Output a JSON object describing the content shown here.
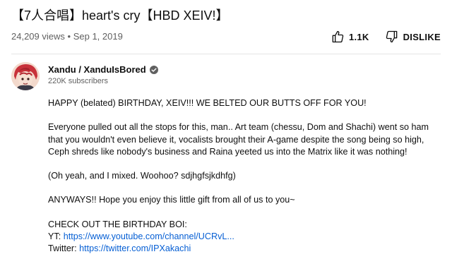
{
  "video": {
    "title": "【7人合唱】heart's cry【HBD XEIV!】",
    "views": "24,209 views",
    "separator": "•",
    "date": "Sep 1, 2019",
    "likes": "1.1K",
    "dislike_label": "DISLIKE"
  },
  "channel": {
    "name": "Xandu / XanduIsBored",
    "subscribers": "220K subscribers",
    "verified_icon": "check-circle-icon"
  },
  "description": {
    "p1": "HAPPY (belated) BIRTHDAY, XEIV!!! WE BELTED OUR BUTTS OFF FOR YOU!",
    "p2_line1": "Everyone pulled out all the stops for this, man.. Art team (chessu, Dom and Shachi) went so ham",
    "p2_line2": "that you wouldn't even believe it, vocalists brought their A-game despite the song being so high,",
    "p2_line3": "Ceph shreds like nobody's business and Raina yeeted us into the Matrix like it was nothing!",
    "p3": "(Oh yeah, and I mixed. Woohoo? sdjhgfsjkdhfg)",
    "p4": "ANYWAYS!! Hope you enjoy this little gift from all of us to you~",
    "p5": "CHECK OUT THE BIRTHDAY BOI:",
    "yt_label": "YT:",
    "yt_link": "https://www.youtube.com/channel/UCRvL...",
    "twitter_label": "Twitter:",
    "twitter_link": "https://twitter.com/IPXakachi"
  },
  "colors": {
    "link": "#065fd4",
    "secondary_text": "#606060",
    "primary_text": "#0f0f0f"
  },
  "icons": {
    "like": "thumb-up-icon",
    "dislike": "thumb-down-icon"
  }
}
